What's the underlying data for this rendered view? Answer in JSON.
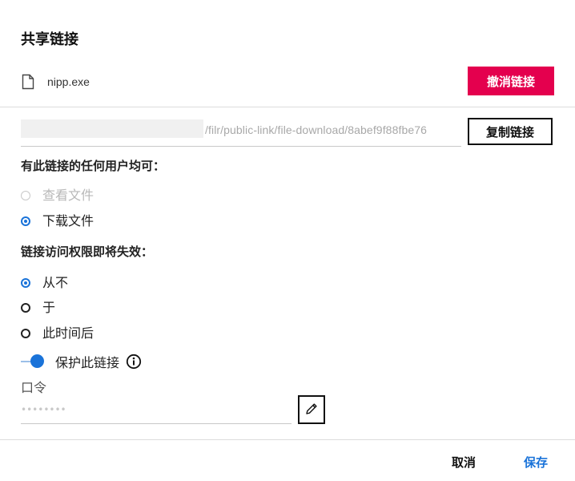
{
  "dialog": {
    "title": "共享链接"
  },
  "file": {
    "icon": "file-icon",
    "name": "nipp.exe"
  },
  "revoke_button": {
    "label": "撤消链接",
    "color": "#e4004e"
  },
  "link": {
    "path": "/filr/public-link/file-download/8abef9f88fbe76",
    "copy_label": "复制链接"
  },
  "permissions": {
    "heading": "有此链接的任何用户均可：",
    "options": [
      {
        "label": "查看文件",
        "checked": false,
        "disabled": true
      },
      {
        "label": "下载文件",
        "checked": true,
        "disabled": false
      }
    ]
  },
  "expiry": {
    "heading": "链接访问权限即将失效：",
    "options": [
      {
        "label": "从不",
        "checked": true
      },
      {
        "label": "于",
        "checked": false
      },
      {
        "label": "此时间后",
        "checked": false
      }
    ]
  },
  "protect": {
    "label": "保护此链接",
    "enabled": true,
    "info_icon": "info-icon"
  },
  "password": {
    "label": "口令",
    "value": "••••••••",
    "edit_icon": "pencil-icon"
  },
  "footer": {
    "cancel_label": "取消",
    "save_label": "保存"
  },
  "colors": {
    "accent": "#1a73d9",
    "danger": "#e4004e"
  }
}
